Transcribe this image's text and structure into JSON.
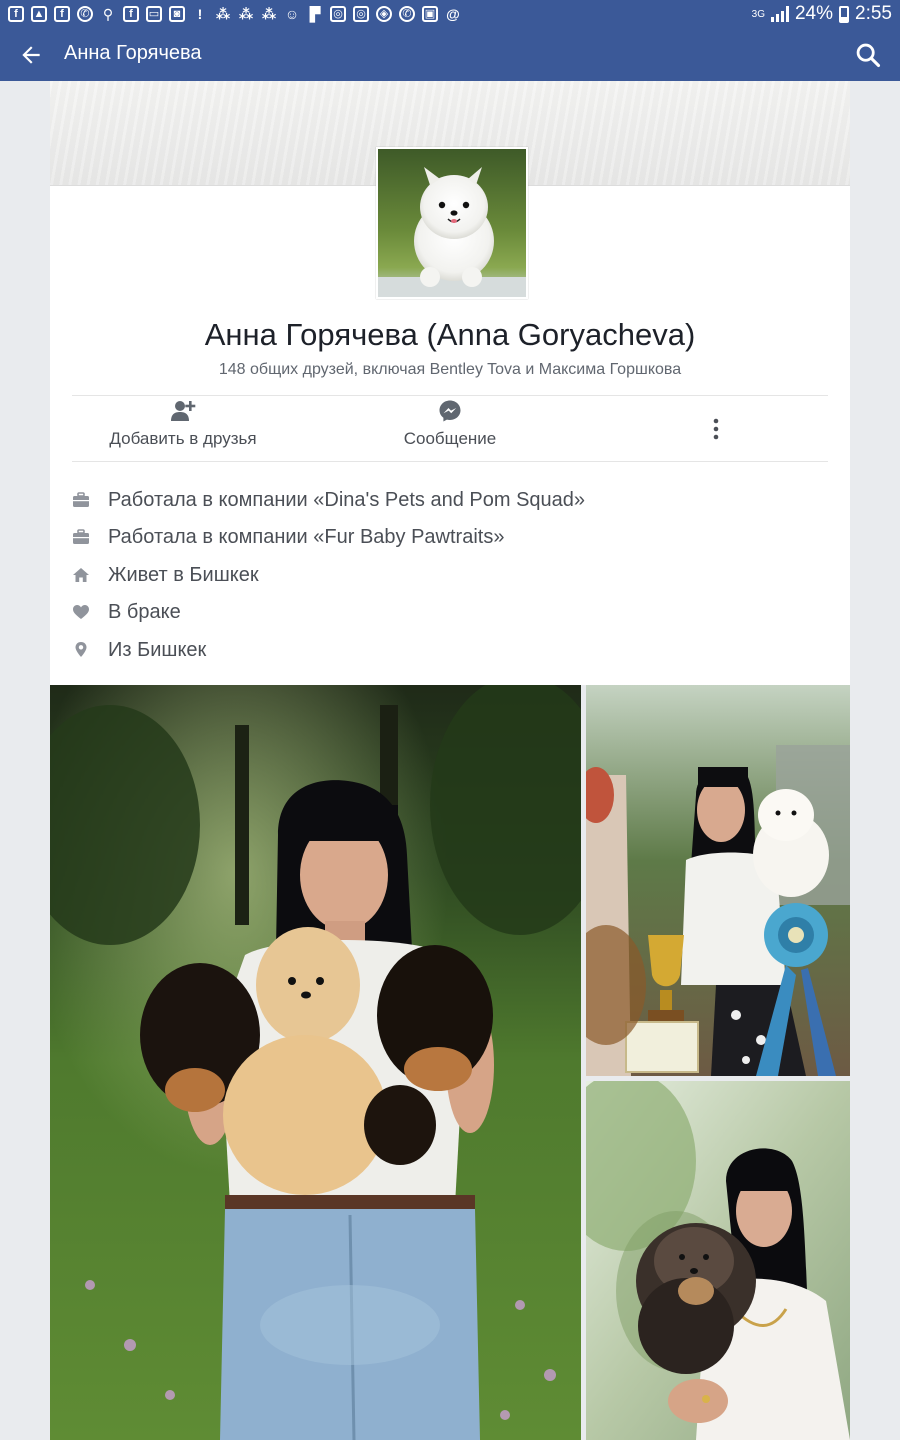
{
  "status_bar": {
    "network": "3G",
    "battery": "24%",
    "time": "2:55",
    "notification_icons": [
      "facebook-icon",
      "android-icon",
      "facebook-icon",
      "whatsapp-icon",
      "search-icon",
      "facebook-icon",
      "gallery-icon",
      "instagram-icon",
      "alert-icon",
      "group-icon",
      "group-icon",
      "group-icon",
      "ok-icon",
      "flipboard-icon",
      "instagram-icon",
      "instagram-icon",
      "shield-icon",
      "viber-icon",
      "gallery-icon",
      "email-icon"
    ]
  },
  "app_bar": {
    "title": "Анна Горячева"
  },
  "profile": {
    "name": "Анна Горячева (Anna Goryacheva)",
    "mutual_friends": "148 общих друзей, включая Bentley Tova и Максима Горшкова"
  },
  "actions": {
    "add_friend": "Добавить в друзья",
    "message": "Сообщение"
  },
  "info": [
    {
      "icon": "briefcase-icon",
      "text": "Работала в компании «Dina's Pets and Pom Squad»"
    },
    {
      "icon": "briefcase-icon",
      "text": "Работала в компании «Fur Baby Pawtraits»"
    },
    {
      "icon": "home-icon",
      "text": "Живет в Бишкек"
    },
    {
      "icon": "heart-icon",
      "text": "В браке"
    },
    {
      "icon": "location-pin-icon",
      "text": "Из Бишкек"
    }
  ],
  "colors": {
    "brand": "#3b5998",
    "text_primary": "#1d2129",
    "text_secondary": "#616770",
    "icon": "#90949c"
  }
}
